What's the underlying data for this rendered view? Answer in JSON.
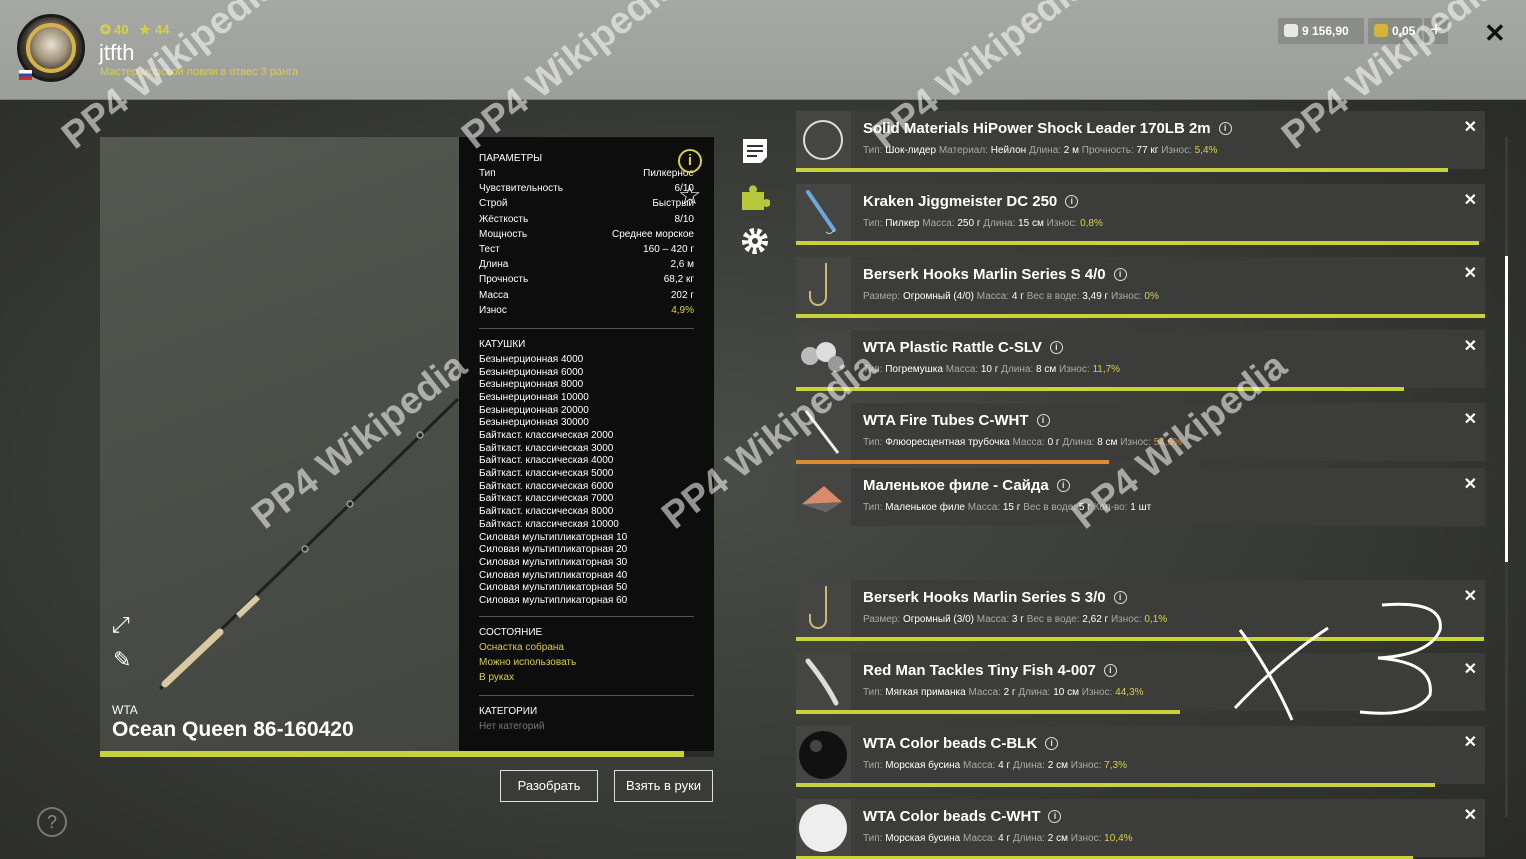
{
  "header": {
    "currency_green": "40",
    "currency_gold_level": "44",
    "username": "jtfth",
    "rank": "Мастер морской ловли в отвес 3 ранга",
    "silver": "9 156,90",
    "gold": "0,05",
    "plus": "+",
    "close": "✕"
  },
  "rod": {
    "brand": "WTA",
    "name": "Ocean Queen 86-160420",
    "wear_fraction": 0.951
  },
  "params": {
    "title": "ПАРАМЕТРЫ",
    "rows": [
      {
        "label": "Тип",
        "value": "Пилкерное"
      },
      {
        "label": "Чувствительность",
        "value": "6/10"
      },
      {
        "label": "Строй",
        "value": "Быстрый"
      },
      {
        "label": "Жёсткость",
        "value": "8/10"
      },
      {
        "label": "Мощность",
        "value": "Среднее морское"
      },
      {
        "label": "Тест",
        "value": "160 – 420 г"
      },
      {
        "label": "Длина",
        "value": "2,6 м"
      },
      {
        "label": "Прочность",
        "value": "68,2 кг"
      },
      {
        "label": "Масса",
        "value": "202 г"
      },
      {
        "label": "Износ",
        "value": "4,9%"
      }
    ],
    "reels_title": "КАТУШКИ",
    "reels": [
      "Безынерционная 4000",
      "Безынерционная 6000",
      "Безынерционная 8000",
      "Безынерционная 10000",
      "Безынерционная 20000",
      "Безынерционная 30000",
      "Байткаст. классическая 2000",
      "Байткаст. классическая 3000",
      "Байткаст. классическая 4000",
      "Байткаст. классическая 5000",
      "Байткаст. классическая 6000",
      "Байткаст. классическая 7000",
      "Байткаст. классическая 8000",
      "Байткаст. классическая 10000",
      "Силовая мультипликаторная 10",
      "Силовая мультипликаторная 20",
      "Силовая мультипликаторная 30",
      "Силовая мультипликаторная 40",
      "Силовая мультипликаторная 50",
      "Силовая мультипликаторная 60"
    ],
    "state_title": "СОСТОЯНИЕ",
    "states": [
      "Оснастка собрана",
      "Можно использовать",
      "В руках"
    ],
    "categories_title": "КАТЕГОРИИ",
    "categories_value": "Нет категорий"
  },
  "buttons": {
    "disassemble": "Разобрать",
    "take": "Взять в руки"
  },
  "items": [
    {
      "name": "Solid Materials HiPower Shock Leader 170LB 2m",
      "desc": [
        [
          "Тип:",
          "Шок-лидер"
        ],
        [
          "Материал:",
          "Нейлон"
        ],
        [
          "Длина:",
          "2 м"
        ],
        [
          "Прочность:",
          "77 кг"
        ]
      ],
      "wear_label": "Износ:",
      "wear": "5,4%",
      "wear_fraction": 0.946,
      "bar_color": "#c8d23a"
    },
    {
      "name": "Kraken Jiggmeister DC 250",
      "desc": [
        [
          "Тип:",
          "Пилкер"
        ],
        [
          "Масса:",
          "250 г"
        ],
        [
          "Длина:",
          "15 см"
        ]
      ],
      "wear_label": "Износ:",
      "wear": "0,8%",
      "wear_fraction": 0.992,
      "bar_color": "#c8d23a"
    },
    {
      "name": "Berserk Hooks Marlin Series S 4/0",
      "desc": [
        [
          "Размер:",
          "Огромный (4/0)"
        ],
        [
          "Масса:",
          "4 г"
        ],
        [
          "Вес в воде:",
          "3,49 г"
        ]
      ],
      "wear_label": "Износ:",
      "wear": "0%",
      "wear_fraction": 1.0,
      "bar_color": "#c8d23a"
    },
    {
      "name": "WTA Plastic Rattle C-SLV",
      "desc": [
        [
          "Тип:",
          "Погремушка"
        ],
        [
          "Масса:",
          "10 г"
        ],
        [
          "Длина:",
          "8 см"
        ]
      ],
      "wear_label": "Износ:",
      "wear": "11,7%",
      "wear_fraction": 0.883,
      "bar_color": "#c8d23a"
    },
    {
      "name": "WTA Fire Tubes C-WHT",
      "desc": [
        [
          "Тип:",
          "Флюоресцентная трубочка"
        ],
        [
          "Масса:",
          "0 г"
        ],
        [
          "Длина:",
          "8 см"
        ]
      ],
      "wear_label": "Износ:",
      "wear": "54,6%",
      "wear_fraction": 0.454,
      "bar_color": "#e08a2a"
    },
    {
      "name": "Маленькое филе - Сайда",
      "desc": [
        [
          "Тип:",
          "Маленькое филе"
        ],
        [
          "Масса:",
          "15 г"
        ],
        [
          "Вес в воде:",
          "5 г"
        ],
        [
          "Кол-во:",
          "1 шт"
        ]
      ],
      "wear_label": "",
      "wear": "",
      "wear_fraction": 0,
      "bar_color": "#c8d23a"
    },
    {
      "name": "Berserk Hooks Marlin Series S 3/0",
      "desc": [
        [
          "Размер:",
          "Огромный (3/0)"
        ],
        [
          "Масса:",
          "3 г"
        ],
        [
          "Вес в воде:",
          "2,62 г"
        ]
      ],
      "wear_label": "Износ:",
      "wear": "0,1%",
      "wear_fraction": 0.999,
      "bar_color": "#c8d23a"
    },
    {
      "name": "Red Man Tackles Tiny Fish 4-007",
      "desc": [
        [
          "Тип:",
          "Мягкая приманка"
        ],
        [
          "Масса:",
          "2 г"
        ],
        [
          "Длина:",
          "10 см"
        ]
      ],
      "wear_label": "Износ:",
      "wear": "44,3%",
      "wear_fraction": 0.557,
      "bar_color": "#c8d23a"
    },
    {
      "name": "WTA Color beads C-BLK",
      "desc": [
        [
          "Тип:",
          "Морская бусина"
        ],
        [
          "Масса:",
          "4 г"
        ],
        [
          "Длина:",
          "2 см"
        ]
      ],
      "wear_label": "Износ:",
      "wear": "7,3%",
      "wear_fraction": 0.927,
      "bar_color": "#c8d23a"
    },
    {
      "name": "WTA Color beads C-WHT",
      "desc": [
        [
          "Тип:",
          "Морская бусина"
        ],
        [
          "Масса:",
          "4 г"
        ],
        [
          "Длина:",
          "2 см"
        ]
      ],
      "wear_label": "Износ:",
      "wear": "10,4%",
      "wear_fraction": 0.896,
      "bar_color": "#c8d23a"
    }
  ],
  "watermark": "PP4 Wikipedia"
}
